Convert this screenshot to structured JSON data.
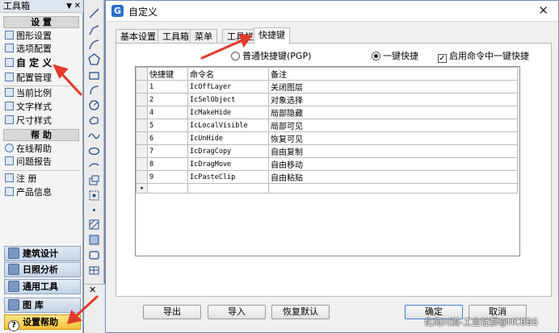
{
  "toolbox": {
    "title": "工具箱",
    "section_settings": "设  置",
    "items_settings": [
      "图形设置",
      "选项配置",
      "自 定 义",
      "配置管理",
      "当前比例",
      "文字样式",
      "尺寸样式"
    ],
    "section_help": "帮  助",
    "items_help": [
      "在线帮助",
      "问题报告"
    ],
    "items_other": [
      "注    册",
      "产品信息"
    ],
    "bottom_buttons": [
      "建筑设计",
      "日照分析",
      "通用工具",
      "图    库",
      "设置帮助"
    ]
  },
  "dialog": {
    "title": "自定义",
    "tabs": [
      "基本设置",
      "工具箱",
      "菜单",
      "工具栏",
      "快捷键"
    ],
    "active_tab": "快捷键",
    "radio_normal": "普通快捷键(PGP)",
    "radio_onekey": "一键快捷",
    "check_enable": "启用命令中一键快捷",
    "grid": {
      "headers": [
        "快捷键",
        "命令名",
        "备注"
      ],
      "rows": [
        [
          "1",
          "IcOffLayer",
          "关闭图层"
        ],
        [
          "2",
          "IcSelObject",
          "对象选择"
        ],
        [
          "4",
          "IcMakeHide",
          "局部隐藏"
        ],
        [
          "5",
          "IcLocalVisible",
          "局部可见"
        ],
        [
          "6",
          "IcUnHide",
          "恢复可见"
        ],
        [
          "7",
          "IcDragCopy",
          "自由复制"
        ],
        [
          "8",
          "IcDragMove",
          "自由移动"
        ],
        [
          "9",
          "IcPasteClip",
          "自由粘贴"
        ]
      ]
    },
    "buttons": {
      "export": "导出",
      "import": "导入",
      "restore": "恢复默认",
      "ok": "确定",
      "cancel": "取消"
    }
  },
  "watermark": "化海川流-工业社群@HCBBS",
  "colors": {
    "accent": "#e23a2a",
    "selected_button": "#f5c238"
  }
}
